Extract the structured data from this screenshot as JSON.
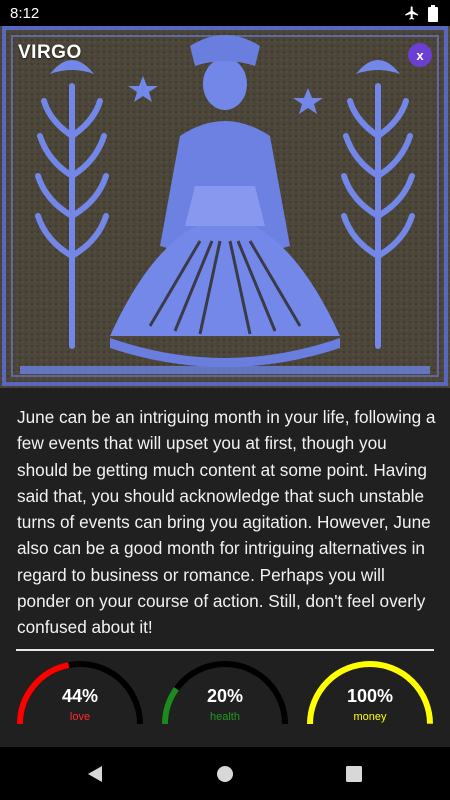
{
  "status_bar": {
    "time": "8:12",
    "icons": [
      "airplane-mode-icon",
      "battery-icon"
    ]
  },
  "header": {
    "title": "VIRGO",
    "close_label": "x"
  },
  "horoscope": {
    "text": "June can be an intriguing month in your life, following a few events that will upset you at first, though you should be getting much content at some point. Having said that, you should acknowledge that such unstable turns of events can bring you agitation. However, June also can be a good month for intriguing alternatives in regard to business or romance. Perhaps you will ponder on your course of action. Still, don't feel overly confused about it!"
  },
  "gauges": [
    {
      "value_text": "44%",
      "label": "love",
      "fraction": 0.44,
      "color": "#ff0000"
    },
    {
      "value_text": "20%",
      "label": "health",
      "fraction": 0.2,
      "color": "#1c8a1c"
    },
    {
      "value_text": "100%",
      "label": "money",
      "fraction": 1.0,
      "color": "#ffff00"
    }
  ],
  "colors": {
    "track": "#000000",
    "accent": "#6a3fd1",
    "background": "#202020"
  },
  "nav": {
    "icons": [
      "back-triangle-icon",
      "home-circle-icon",
      "recents-square-icon"
    ]
  }
}
